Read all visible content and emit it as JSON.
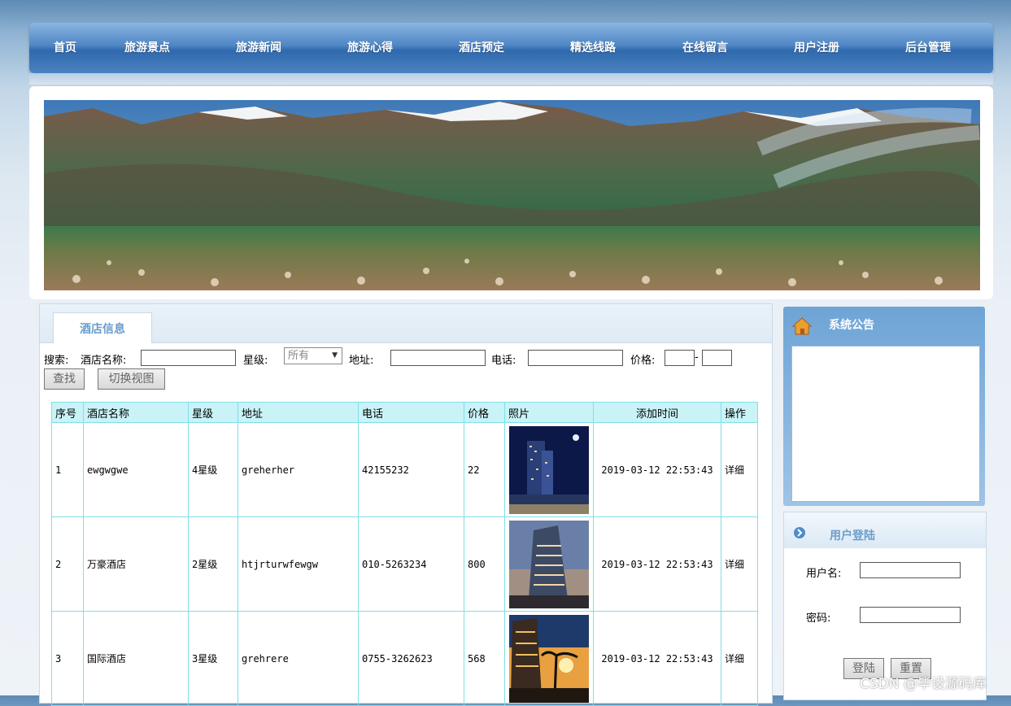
{
  "nav": {
    "items": [
      "首页",
      "旅游景点",
      "旅游新闻",
      "旅游心得",
      "酒店预定",
      "精选线路",
      "在线留言",
      "用户注册",
      "后台管理"
    ]
  },
  "main": {
    "tab_label": "酒店信息",
    "search": {
      "prefix": "搜索:",
      "name_label": "酒店名称:",
      "star_label": "星级:",
      "star_selected": "所有",
      "address_label": "地址:",
      "phone_label": "电话:",
      "price_label": "价格:",
      "price_separator": "-",
      "search_button": "查找",
      "switch_view_button": "切换视图"
    },
    "table": {
      "headers": [
        "序号",
        "酒店名称",
        "星级",
        "地址",
        "电话",
        "价格",
        "照片",
        "添加时间",
        "操作"
      ],
      "rows": [
        {
          "no": "1",
          "name": "ewgwgwe",
          "star": "4星级",
          "address": "greherher",
          "phone": "42155232",
          "price": "22",
          "time": "2019-03-12 22:53:43",
          "action": "详细"
        },
        {
          "no": "2",
          "name": "万豪酒店",
          "star": "2星级",
          "address": "htjrturwfewgw",
          "phone": "010-5263234",
          "price": "800",
          "time": "2019-03-12 22:53:43",
          "action": "详细"
        },
        {
          "no": "3",
          "name": "国际酒店",
          "star": "3星级",
          "address": "grehrere",
          "phone": "0755-3262623",
          "price": "568",
          "time": "2019-03-12 22:53:43",
          "action": "详细"
        }
      ]
    }
  },
  "sidebar": {
    "notice_title": "系统公告",
    "login_title": "用户登陆",
    "username_label": "用户名:",
    "password_label": "密码:",
    "login_button": "登陆",
    "reset_button": "重置"
  },
  "watermark": "CSDN @毕设源码库",
  "colors": {
    "nav": "#3f79ba",
    "table_border": "#7fdfe6",
    "table_header": "#c9f3f7",
    "accent": "#6a9dcc"
  }
}
